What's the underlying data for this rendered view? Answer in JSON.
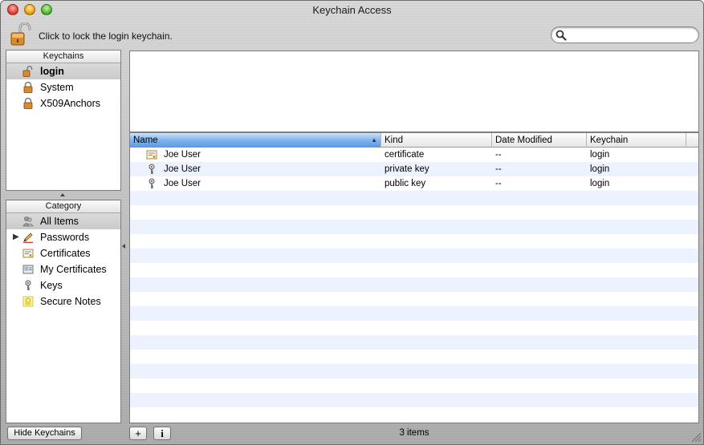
{
  "window": {
    "title": "Keychain Access",
    "traffic_lights": [
      "close",
      "minimize",
      "zoom"
    ]
  },
  "toolbar": {
    "lock_icon": "unlocked-padlock-icon",
    "lock_label": "Click to lock the login keychain.",
    "search": {
      "value": "",
      "placeholder": "",
      "icon": "magnifier-icon"
    }
  },
  "keychains": {
    "header": "Keychains",
    "items": [
      {
        "label": "login",
        "icon": "unlocked-padlock-icon",
        "selected": true
      },
      {
        "label": "System",
        "icon": "padlock-icon",
        "selected": false
      },
      {
        "label": "X509Anchors",
        "icon": "padlock-icon",
        "selected": false
      }
    ]
  },
  "category": {
    "header": "Category",
    "items": [
      {
        "label": "All Items",
        "icon": "people-icon",
        "selected": true
      },
      {
        "label": "Passwords",
        "icon": "pencil-icon",
        "selected": false,
        "has_disclosure": true
      },
      {
        "label": "Certificates",
        "icon": "certificate-icon",
        "selected": false
      },
      {
        "label": "My Certificates",
        "icon": "my-certificate-icon",
        "selected": false
      },
      {
        "label": "Keys",
        "icon": "key-icon",
        "selected": false
      },
      {
        "label": "Secure Notes",
        "icon": "note-icon",
        "selected": false
      }
    ]
  },
  "table": {
    "columns": [
      "Name",
      "Kind",
      "Date Modified",
      "Keychain"
    ],
    "sorted_column": "Name",
    "rows": [
      {
        "icon": "certificate-icon",
        "name": "Joe User",
        "kind": "certificate",
        "date": "--",
        "keychain": "login"
      },
      {
        "icon": "key-icon",
        "name": "Joe User",
        "kind": "private key",
        "date": "--",
        "keychain": "login"
      },
      {
        "icon": "key-icon",
        "name": "Joe User",
        "kind": "public key",
        "date": "--",
        "keychain": "login"
      }
    ],
    "empty_rows": 16
  },
  "bottom_bar": {
    "hide_keychains_label": "Hide Keychains",
    "add_label": "+",
    "info_label": "i",
    "status": "3 items"
  },
  "colors": {
    "selection_gray": "#cdcdcd",
    "sorted_header_blue": "#7fb3ec",
    "stripe_blue": "#edf3fe"
  }
}
